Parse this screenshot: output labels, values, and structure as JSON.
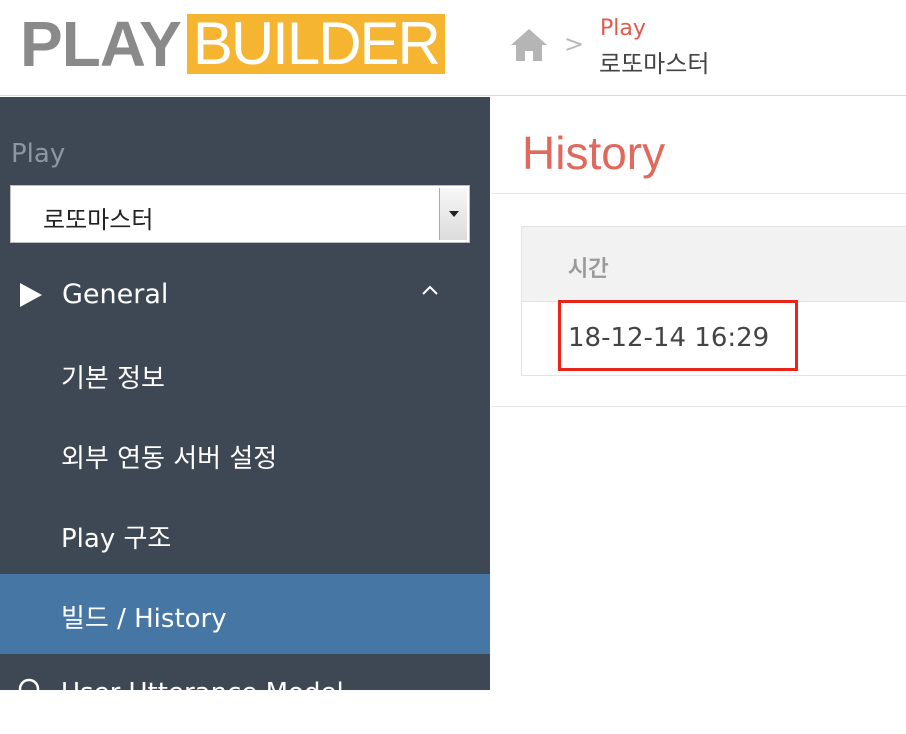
{
  "header": {
    "logo_play": "PLAY",
    "logo_builder": "BUILDER",
    "breadcrumb_separator": ">",
    "breadcrumb_section": "Play",
    "breadcrumb_current": "로또마스터",
    "icons": {
      "home": "home-icon"
    }
  },
  "sidebar": {
    "play_label": "Play",
    "play_select": {
      "value": "로또마스터"
    },
    "group": {
      "label": "General",
      "expanded": true
    },
    "items": [
      {
        "label": "기본 정보",
        "active": false
      },
      {
        "label": "외부 연동 서버 설정",
        "active": false
      },
      {
        "label": "Play 구조",
        "active": false
      },
      {
        "label": "빌드 / History",
        "active": true
      },
      {
        "label": "User Utterance Model",
        "active": false,
        "icon": "marker-icon"
      }
    ]
  },
  "main": {
    "title": "History",
    "table": {
      "columns": [
        "시간"
      ],
      "rows": [
        [
          "18-12-14 16:29"
        ]
      ]
    }
  },
  "colors": {
    "sidebar_bg": "#3e4854",
    "active_item_bg": "#4676a4",
    "logo_accent": "#f6b530",
    "title_color": "#e0685c",
    "highlight_border": "#e8241b"
  }
}
